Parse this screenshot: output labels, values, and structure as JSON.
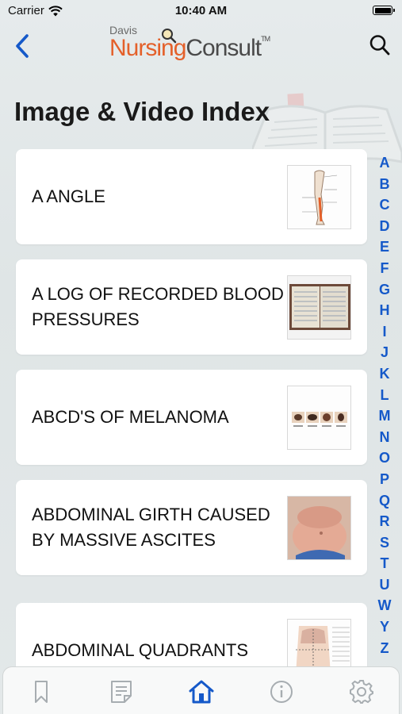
{
  "status_bar": {
    "carrier": "Carrier",
    "time": "10:40 AM"
  },
  "nav": {
    "logo": {
      "davis": "Davis",
      "nursing": "Nursing",
      "consult": "Consult",
      "tm": "TM"
    },
    "back_icon": "chevron-left-icon",
    "search_icon": "search-icon"
  },
  "page": {
    "title": "Image & Video Index"
  },
  "items": [
    {
      "label": "A ANGLE",
      "thumb": "leg-anatomy-thumbnail"
    },
    {
      "label": "A LOG OF RECORDED BLOOD PRESSURES",
      "thumb": "logbook-thumbnail"
    },
    {
      "label": "ABCD'S OF MELANOMA",
      "thumb": "melanoma-thumbnail"
    },
    {
      "label": "ABDOMINAL GIRTH CAUSED BY MASSIVE ASCITES",
      "thumb": "ascites-thumbnail"
    },
    {
      "label": "ABDOMINAL QUADRANTS",
      "thumb": "quadrants-thumbnail"
    }
  ],
  "alphabet": [
    "A",
    "B",
    "C",
    "D",
    "E",
    "F",
    "G",
    "H",
    "I",
    "J",
    "K",
    "L",
    "M",
    "N",
    "O",
    "P",
    "Q",
    "R",
    "S",
    "T",
    "U",
    "W",
    "Y",
    "Z"
  ],
  "tabbar": {
    "tabs": [
      {
        "icon": "bookmark-icon",
        "active": false
      },
      {
        "icon": "notes-icon",
        "active": false
      },
      {
        "icon": "home-icon",
        "active": true
      },
      {
        "icon": "info-icon",
        "active": false
      },
      {
        "icon": "gear-icon",
        "active": false
      }
    ],
    "active_color": "#1559c9",
    "inactive_color": "#a7adb1"
  },
  "colors": {
    "accent": "#1559c9",
    "brand_orange": "#e4602a"
  }
}
